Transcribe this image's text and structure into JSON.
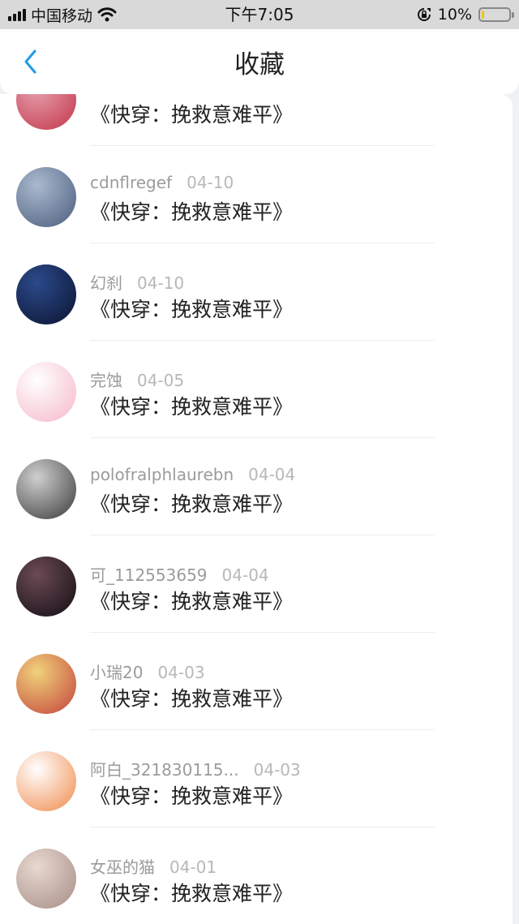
{
  "status_bar": {
    "carrier": "中国移动",
    "time": "下午7:05",
    "battery": "10%",
    "battery_level": 0.1,
    "icons": [
      "signal-icon",
      "wifi-icon",
      "rotation-lock-icon",
      "battery-icon"
    ]
  },
  "nav": {
    "title": "收藏",
    "back_icon": "chevron-left-icon",
    "accent": "#1e9be9"
  },
  "items": [
    {
      "user": "",
      "date": "",
      "book": "《快穿：挽救意难平》",
      "avatar_colors": [
        "#e7a0ad",
        "#c2354a"
      ]
    },
    {
      "user": "cdnflregef",
      "date": "04-10",
      "book": "《快穿：挽救意难平》",
      "avatar_colors": [
        "#aab9cf",
        "#4a5d7c"
      ]
    },
    {
      "user": "幻刹",
      "date": "04-10",
      "book": "《快穿：挽救意难平》",
      "avatar_colors": [
        "#2b4a8a",
        "#0b1330"
      ]
    },
    {
      "user": "完蚀",
      "date": "04-05",
      "book": "《快穿：挽救意难平》",
      "avatar_colors": [
        "#ffffff",
        "#f5b7c8"
      ]
    },
    {
      "user": "polofralphlaurebn",
      "date": "04-04",
      "book": "《快穿：挽救意难平》",
      "avatar_colors": [
        "#cfcfcf",
        "#3a3a3a"
      ]
    },
    {
      "user": "可_112553659",
      "date": "04-04",
      "book": "《快穿：挽救意难平》",
      "avatar_colors": [
        "#6b4a55",
        "#120d12"
      ]
    },
    {
      "user": "小瑞20",
      "date": "04-03",
      "book": "《快穿：挽救意难平》",
      "avatar_colors": [
        "#f0d27a",
        "#c4423c"
      ]
    },
    {
      "user": "阿白_321830115...",
      "date": "04-03",
      "book": "《快穿：挽救意难平》",
      "avatar_colors": [
        "#ffffff",
        "#f08a4b"
      ]
    },
    {
      "user": "女巫的猫",
      "date": "04-01",
      "book": "《快穿：挽救意难平》",
      "avatar_colors": [
        "#e8d8d0",
        "#a58d86"
      ]
    }
  ]
}
